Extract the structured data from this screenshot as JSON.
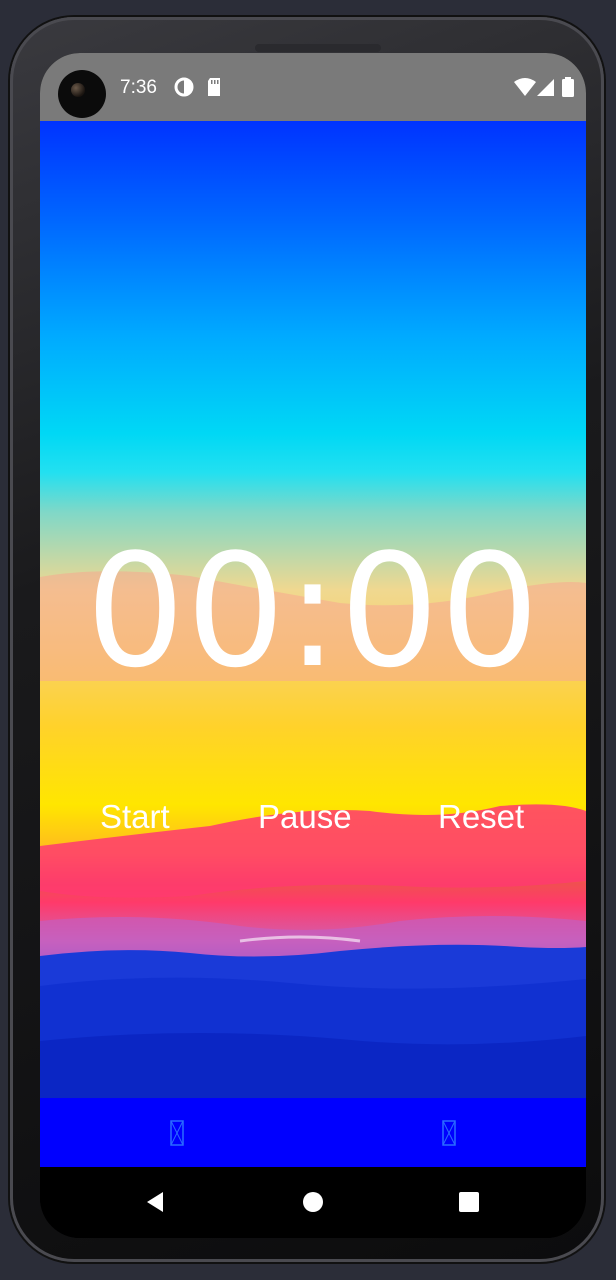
{
  "status_bar": {
    "time": "7:36",
    "left_icons": [
      "data-saver-icon",
      "sd-card-icon"
    ],
    "right_icons": [
      "wifi-icon",
      "signal-icon",
      "battery-icon"
    ]
  },
  "timer": {
    "display": "00:00"
  },
  "controls": {
    "start_label": "Start",
    "pause_label": "Pause",
    "reset_label": "Reset"
  },
  "bottom_bar": {
    "items": [
      "missing-glyph-icon",
      "missing-glyph-icon"
    ]
  },
  "navigation": {
    "back": "back-icon",
    "home": "home-icon",
    "recents": "recents-icon"
  },
  "colors": {
    "status_bar": "#7a7a7a",
    "bottom_bar": "#0000ff",
    "text": "#ffffff"
  }
}
